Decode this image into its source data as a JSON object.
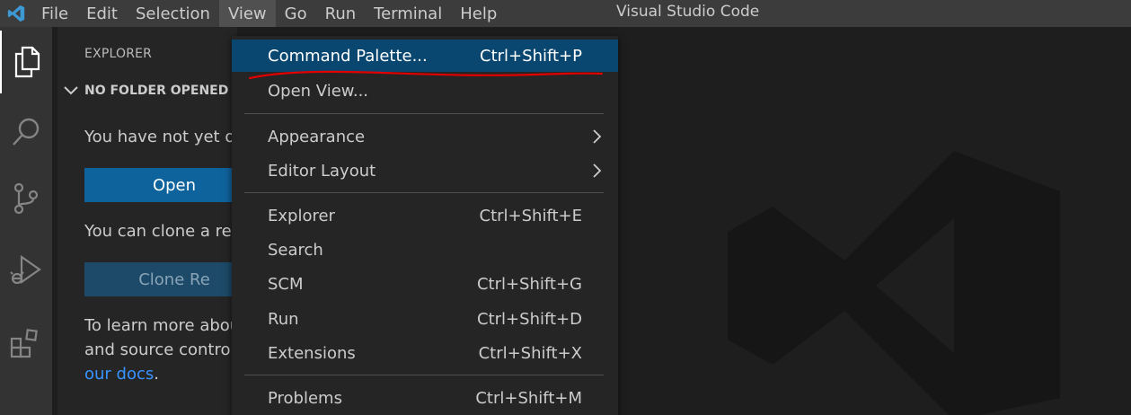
{
  "titlebar": {
    "logo_icon": "vscode-logo-icon",
    "window_title": "Visual Studio Code",
    "menus": [
      "File",
      "Edit",
      "Selection",
      "View",
      "Go",
      "Run",
      "Terminal",
      "Help"
    ],
    "active_menu": "View"
  },
  "activitybar": {
    "icons": [
      "explorer-icon",
      "search-icon",
      "source-control-icon",
      "run-debug-icon",
      "extensions-icon"
    ],
    "active": "explorer-icon"
  },
  "sidebar": {
    "title": "EXPLORER",
    "section": "NO FOLDER OPENED",
    "text_not_opened": "You have not yet op",
    "open_button": "Open",
    "text_clone": "You can clone a rep",
    "clone_button": "Clone Re",
    "learn_line1": "To learn more abou",
    "learn_line2": "and source control",
    "docs_link": "our docs",
    "docs_suffix": "."
  },
  "view_menu": {
    "items": [
      {
        "label": "Command Palette...",
        "shortcut": "Ctrl+Shift+P"
      },
      {
        "label": "Open View...",
        "shortcut": ""
      },
      {
        "label": "Appearance",
        "shortcut": ""
      },
      {
        "label": "Editor Layout",
        "shortcut": ""
      },
      {
        "label": "Explorer",
        "shortcut": "Ctrl+Shift+E"
      },
      {
        "label": "Search",
        "shortcut": ""
      },
      {
        "label": "SCM",
        "shortcut": "Ctrl+Shift+G"
      },
      {
        "label": "Run",
        "shortcut": "Ctrl+Shift+D"
      },
      {
        "label": "Extensions",
        "shortcut": "Ctrl+Shift+X"
      },
      {
        "label": "Problems",
        "shortcut": "Ctrl+Shift+M"
      }
    ],
    "highlighted": "Command Palette...",
    "submenu_icon": "chevron-right-icon"
  },
  "colors": {
    "menu_highlight": "#094771",
    "primary_button": "#0e639c",
    "annotation": "#e00000",
    "link": "#3794ff"
  }
}
